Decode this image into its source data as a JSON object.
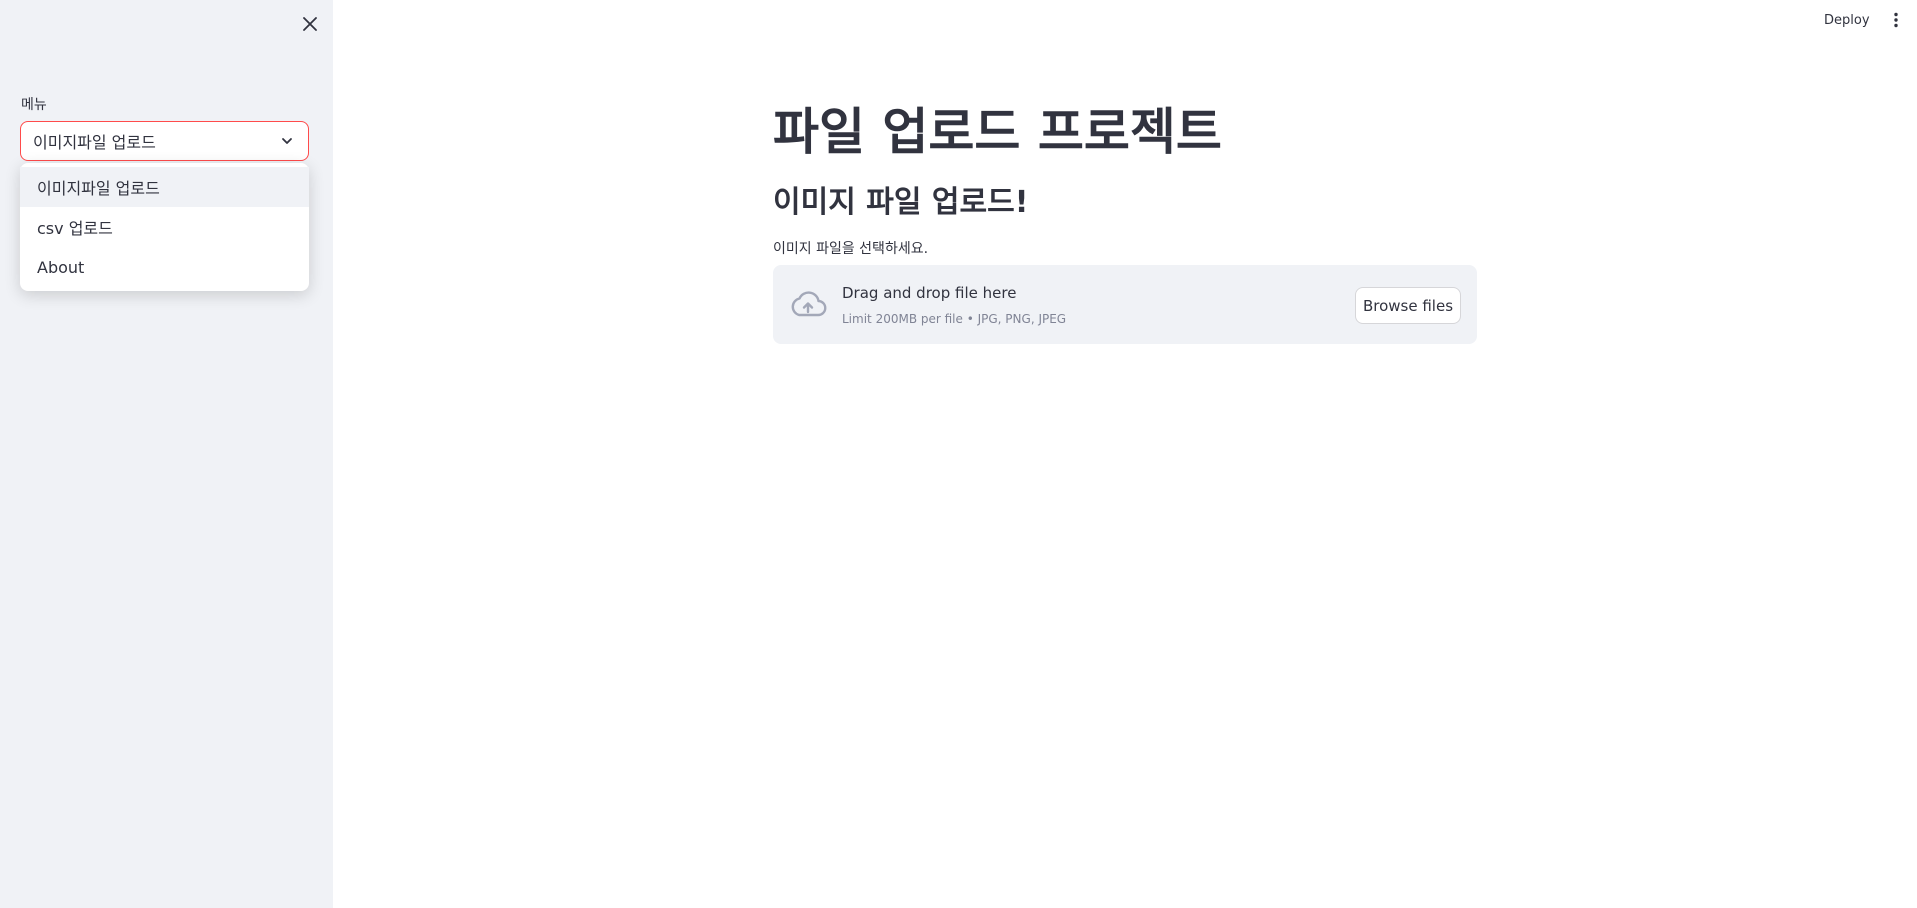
{
  "sidebar": {
    "close_icon": "close-icon",
    "select": {
      "label": "메뉴",
      "value": "이미지파일 업로드",
      "chevron_icon": "chevron-down-icon",
      "options": [
        {
          "label": "이미지파일 업로드",
          "active": true
        },
        {
          "label": "csv 업로드",
          "active": false
        },
        {
          "label": "About",
          "active": false
        }
      ]
    }
  },
  "toolbar": {
    "deploy_label": "Deploy",
    "menu_icon": "kebab-menu-icon"
  },
  "main": {
    "title": "파일 업로드 프로젝트",
    "subtitle": "이미지 파일 업로드!",
    "uploader": {
      "label": "이미지 파일을 선택하세요.",
      "drop_text": "Drag and drop file here",
      "limit_text": "Limit 200MB per file • JPG, PNG, JPEG",
      "browse_label": "Browse files",
      "icon": "cloud-upload-icon"
    }
  },
  "colors": {
    "accent": "#ff4b4b",
    "sidebar_bg": "#f0f2f6",
    "text": "#31333f",
    "muted_text": "#808495",
    "icon_gray": "#a3a8b8"
  }
}
